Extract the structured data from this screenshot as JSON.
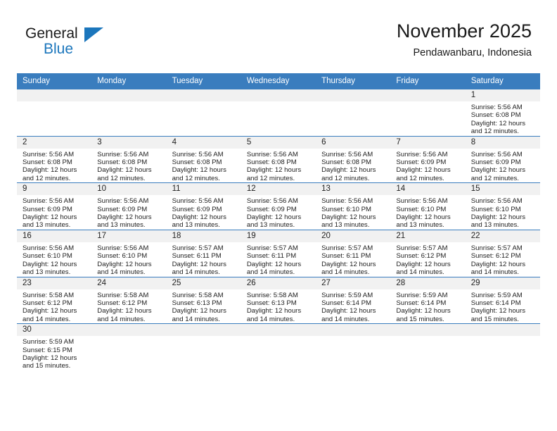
{
  "brand": {
    "name_part1": "General",
    "name_part2": "Blue",
    "flag_icon": "triangle-flag-icon"
  },
  "header": {
    "month_title": "November 2025",
    "location": "Pendawanbaru, Indonesia"
  },
  "theme": {
    "accent": "#3a7dbe",
    "header_text": "#ffffff",
    "daynum_band": "#f1f1f1",
    "body_text": "#222222",
    "brand_blue": "#1b76bc"
  },
  "calendar": {
    "weekday_headers": [
      "Sunday",
      "Monday",
      "Tuesday",
      "Wednesday",
      "Thursday",
      "Friday",
      "Saturday"
    ],
    "weeks": [
      [
        {
          "day": "",
          "blank": true
        },
        {
          "day": "",
          "blank": true
        },
        {
          "day": "",
          "blank": true
        },
        {
          "day": "",
          "blank": true
        },
        {
          "day": "",
          "blank": true
        },
        {
          "day": "",
          "blank": true
        },
        {
          "day": "1",
          "sunrise": "Sunrise: 5:56 AM",
          "sunset": "Sunset: 6:08 PM",
          "daylight_line1": "Daylight: 12 hours",
          "daylight_line2": "and 12 minutes."
        }
      ],
      [
        {
          "day": "2",
          "sunrise": "Sunrise: 5:56 AM",
          "sunset": "Sunset: 6:08 PM",
          "daylight_line1": "Daylight: 12 hours",
          "daylight_line2": "and 12 minutes."
        },
        {
          "day": "3",
          "sunrise": "Sunrise: 5:56 AM",
          "sunset": "Sunset: 6:08 PM",
          "daylight_line1": "Daylight: 12 hours",
          "daylight_line2": "and 12 minutes."
        },
        {
          "day": "4",
          "sunrise": "Sunrise: 5:56 AM",
          "sunset": "Sunset: 6:08 PM",
          "daylight_line1": "Daylight: 12 hours",
          "daylight_line2": "and 12 minutes."
        },
        {
          "day": "5",
          "sunrise": "Sunrise: 5:56 AM",
          "sunset": "Sunset: 6:08 PM",
          "daylight_line1": "Daylight: 12 hours",
          "daylight_line2": "and 12 minutes."
        },
        {
          "day": "6",
          "sunrise": "Sunrise: 5:56 AM",
          "sunset": "Sunset: 6:08 PM",
          "daylight_line1": "Daylight: 12 hours",
          "daylight_line2": "and 12 minutes."
        },
        {
          "day": "7",
          "sunrise": "Sunrise: 5:56 AM",
          "sunset": "Sunset: 6:09 PM",
          "daylight_line1": "Daylight: 12 hours",
          "daylight_line2": "and 12 minutes."
        },
        {
          "day": "8",
          "sunrise": "Sunrise: 5:56 AM",
          "sunset": "Sunset: 6:09 PM",
          "daylight_line1": "Daylight: 12 hours",
          "daylight_line2": "and 12 minutes."
        }
      ],
      [
        {
          "day": "9",
          "sunrise": "Sunrise: 5:56 AM",
          "sunset": "Sunset: 6:09 PM",
          "daylight_line1": "Daylight: 12 hours",
          "daylight_line2": "and 13 minutes."
        },
        {
          "day": "10",
          "sunrise": "Sunrise: 5:56 AM",
          "sunset": "Sunset: 6:09 PM",
          "daylight_line1": "Daylight: 12 hours",
          "daylight_line2": "and 13 minutes."
        },
        {
          "day": "11",
          "sunrise": "Sunrise: 5:56 AM",
          "sunset": "Sunset: 6:09 PM",
          "daylight_line1": "Daylight: 12 hours",
          "daylight_line2": "and 13 minutes."
        },
        {
          "day": "12",
          "sunrise": "Sunrise: 5:56 AM",
          "sunset": "Sunset: 6:09 PM",
          "daylight_line1": "Daylight: 12 hours",
          "daylight_line2": "and 13 minutes."
        },
        {
          "day": "13",
          "sunrise": "Sunrise: 5:56 AM",
          "sunset": "Sunset: 6:10 PM",
          "daylight_line1": "Daylight: 12 hours",
          "daylight_line2": "and 13 minutes."
        },
        {
          "day": "14",
          "sunrise": "Sunrise: 5:56 AM",
          "sunset": "Sunset: 6:10 PM",
          "daylight_line1": "Daylight: 12 hours",
          "daylight_line2": "and 13 minutes."
        },
        {
          "day": "15",
          "sunrise": "Sunrise: 5:56 AM",
          "sunset": "Sunset: 6:10 PM",
          "daylight_line1": "Daylight: 12 hours",
          "daylight_line2": "and 13 minutes."
        }
      ],
      [
        {
          "day": "16",
          "sunrise": "Sunrise: 5:56 AM",
          "sunset": "Sunset: 6:10 PM",
          "daylight_line1": "Daylight: 12 hours",
          "daylight_line2": "and 13 minutes."
        },
        {
          "day": "17",
          "sunrise": "Sunrise: 5:56 AM",
          "sunset": "Sunset: 6:10 PM",
          "daylight_line1": "Daylight: 12 hours",
          "daylight_line2": "and 14 minutes."
        },
        {
          "day": "18",
          "sunrise": "Sunrise: 5:57 AM",
          "sunset": "Sunset: 6:11 PM",
          "daylight_line1": "Daylight: 12 hours",
          "daylight_line2": "and 14 minutes."
        },
        {
          "day": "19",
          "sunrise": "Sunrise: 5:57 AM",
          "sunset": "Sunset: 6:11 PM",
          "daylight_line1": "Daylight: 12 hours",
          "daylight_line2": "and 14 minutes."
        },
        {
          "day": "20",
          "sunrise": "Sunrise: 5:57 AM",
          "sunset": "Sunset: 6:11 PM",
          "daylight_line1": "Daylight: 12 hours",
          "daylight_line2": "and 14 minutes."
        },
        {
          "day": "21",
          "sunrise": "Sunrise: 5:57 AM",
          "sunset": "Sunset: 6:12 PM",
          "daylight_line1": "Daylight: 12 hours",
          "daylight_line2": "and 14 minutes."
        },
        {
          "day": "22",
          "sunrise": "Sunrise: 5:57 AM",
          "sunset": "Sunset: 6:12 PM",
          "daylight_line1": "Daylight: 12 hours",
          "daylight_line2": "and 14 minutes."
        }
      ],
      [
        {
          "day": "23",
          "sunrise": "Sunrise: 5:58 AM",
          "sunset": "Sunset: 6:12 PM",
          "daylight_line1": "Daylight: 12 hours",
          "daylight_line2": "and 14 minutes."
        },
        {
          "day": "24",
          "sunrise": "Sunrise: 5:58 AM",
          "sunset": "Sunset: 6:12 PM",
          "daylight_line1": "Daylight: 12 hours",
          "daylight_line2": "and 14 minutes."
        },
        {
          "day": "25",
          "sunrise": "Sunrise: 5:58 AM",
          "sunset": "Sunset: 6:13 PM",
          "daylight_line1": "Daylight: 12 hours",
          "daylight_line2": "and 14 minutes."
        },
        {
          "day": "26",
          "sunrise": "Sunrise: 5:58 AM",
          "sunset": "Sunset: 6:13 PM",
          "daylight_line1": "Daylight: 12 hours",
          "daylight_line2": "and 14 minutes."
        },
        {
          "day": "27",
          "sunrise": "Sunrise: 5:59 AM",
          "sunset": "Sunset: 6:14 PM",
          "daylight_line1": "Daylight: 12 hours",
          "daylight_line2": "and 14 minutes."
        },
        {
          "day": "28",
          "sunrise": "Sunrise: 5:59 AM",
          "sunset": "Sunset: 6:14 PM",
          "daylight_line1": "Daylight: 12 hours",
          "daylight_line2": "and 15 minutes."
        },
        {
          "day": "29",
          "sunrise": "Sunrise: 5:59 AM",
          "sunset": "Sunset: 6:14 PM",
          "daylight_line1": "Daylight: 12 hours",
          "daylight_line2": "and 15 minutes."
        }
      ],
      [
        {
          "day": "30",
          "sunrise": "Sunrise: 5:59 AM",
          "sunset": "Sunset: 6:15 PM",
          "daylight_line1": "Daylight: 12 hours",
          "daylight_line2": "and 15 minutes."
        },
        {
          "day": "",
          "blank": true
        },
        {
          "day": "",
          "blank": true
        },
        {
          "day": "",
          "blank": true
        },
        {
          "day": "",
          "blank": true
        },
        {
          "day": "",
          "blank": true
        },
        {
          "day": "",
          "blank": true
        }
      ]
    ]
  }
}
